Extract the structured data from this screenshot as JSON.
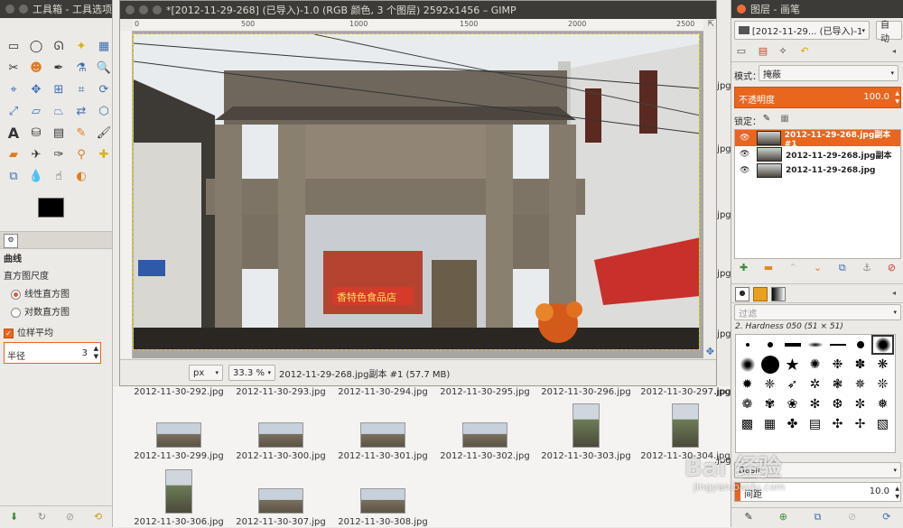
{
  "toolbox": {
    "title": "工具箱 - 工具选项",
    "panel_title": "曲线",
    "histogram_label": "直方图尺度",
    "radio_linear": "线性直方图",
    "radio_log": "对数直方图",
    "sample_average_label": "位样平均",
    "radius_label": "半径",
    "radius_value": "3"
  },
  "image_window": {
    "title": "*[2012-11-29-268] (已导入)-1.0 (RGB 颜色, 3 个图层) 2592x1456 – GIMP",
    "ruler_ticks": [
      "0",
      "500",
      "1000",
      "1500",
      "2000",
      "2500"
    ],
    "unit": "px",
    "zoom": "33.3 %",
    "status_text": "2012-11-29-268.jpg副本 #1 (57.7 MB)",
    "sign_text": "香特色食品店"
  },
  "file_browser": {
    "row1": [
      "2012-11-30-292.jpg",
      "2012-11-30-293.jpg",
      "2012-11-30-294.jpg",
      "2012-11-30-295.jpg",
      "2012-11-30-296.jpg",
      "2012-11-30-297.jpg"
    ],
    "row2": [
      "2012-11-30-299.jpg",
      "2012-11-30-300.jpg",
      "2012-11-30-301.jpg",
      "2012-11-30-302.jpg",
      "2012-11-30-303.jpg",
      "2012-11-30-304.jpg"
    ],
    "row3": [
      "2012-11-30-306.jpg",
      "2012-11-30-307.jpg",
      "2012-11-30-308.jpg"
    ],
    "edge_labels": [
      ".jpg",
      ".jpg",
      ".jpg",
      ".jpg",
      ".jpg",
      ".jpg",
      ".jpg"
    ]
  },
  "layers_dock": {
    "title": "图层 - 画笔",
    "image_selector": "[2012-11-29... (已导入)-1",
    "auto_button": "自动",
    "mode_label": "模式：",
    "mode_value": "掩蔽",
    "opacity_label": "不透明度",
    "opacity_value": "100.0",
    "lock_label": "锁定：",
    "layers": [
      {
        "name": "2012-11-29-268.jpg副本 #1",
        "selected": true
      },
      {
        "name": "2012-11-29-268.jpg副本",
        "selected": false
      },
      {
        "name": "2012-11-29-268.jpg",
        "selected": false
      }
    ],
    "filter_placeholder": "过滤",
    "brush_name": "2. Hardness 050 (51 × 51)",
    "preset_value": "Basic",
    "spacing_label": "间距",
    "spacing_value": "10.0"
  },
  "watermark": {
    "text": "Bai  经验",
    "url": "jingyan.baidu.com"
  },
  "colors": {
    "accent": "#e8661e",
    "titlebar": "#3c3b37"
  }
}
